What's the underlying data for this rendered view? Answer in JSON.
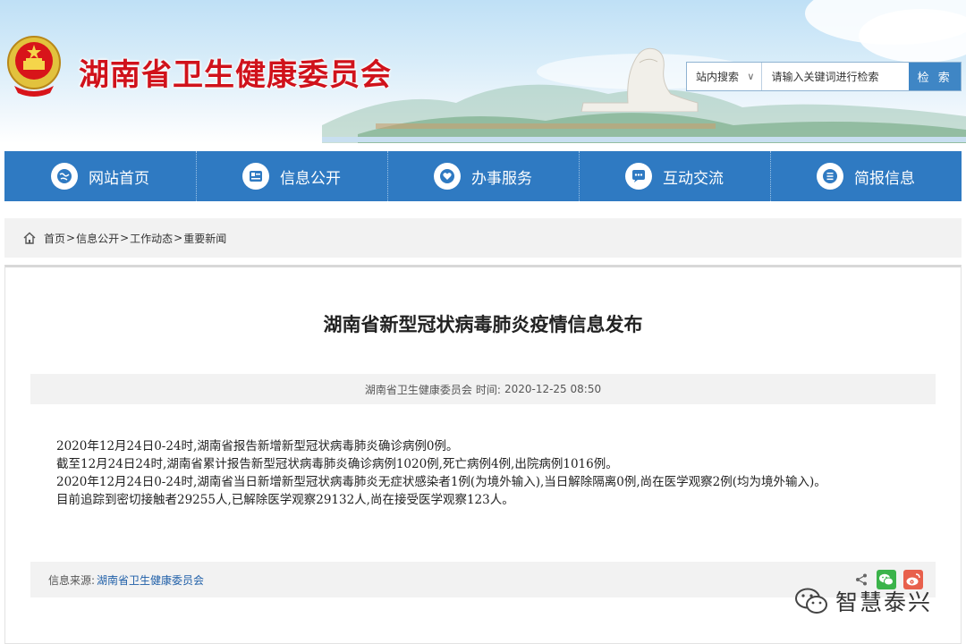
{
  "header": {
    "site_title": "湖南省卫生健康委员会",
    "search": {
      "scope_label": "站内搜索",
      "placeholder": "请输入关键词进行检索",
      "button_label": "检 索"
    }
  },
  "nav": {
    "items": [
      {
        "label": "网站首页",
        "icon": "globe-icon"
      },
      {
        "label": "信息公开",
        "icon": "document-list-icon"
      },
      {
        "label": "办事服务",
        "icon": "heart-icon"
      },
      {
        "label": "互动交流",
        "icon": "chat-icon"
      },
      {
        "label": "简报信息",
        "icon": "report-icon"
      }
    ]
  },
  "breadcrumb": {
    "items": [
      "首页",
      "信息公开",
      "工作动态",
      "重要新闻"
    ],
    "separator": ">"
  },
  "article": {
    "title": "湖南省新型冠状病毒肺炎疫情信息发布",
    "publisher": "湖南省卫生健康委员会",
    "time_label": "时间:",
    "time_value": "2020-12-25 08:50",
    "paragraphs": [
      "2020年12月24日0-24时,湖南省报告新增新型冠状病毒肺炎确诊病例0例。",
      "截至12月24日24时,湖南省累计报告新型冠状病毒肺炎确诊病例1020例,死亡病例4例,出院病例1016例。",
      "2020年12月24日0-24时,湖南省当日新增新型冠状病毒肺炎无症状感染者1例(为境外输入),当日解除隔离0例,尚在医学观察2例(均为境外输入)。",
      "目前追踪到密切接触者29255人,已解除医学观察29132人,尚在接受医学观察123人。"
    ],
    "source_label": "信息来源:",
    "source_value": "湖南省卫生健康委员会"
  },
  "watermark": {
    "text": "智慧泰兴"
  },
  "colors": {
    "brand_red": "#d0121b",
    "nav_blue": "#2f7ac2",
    "wechat_green": "#3bb34a",
    "weibo_red": "#e8604c"
  }
}
